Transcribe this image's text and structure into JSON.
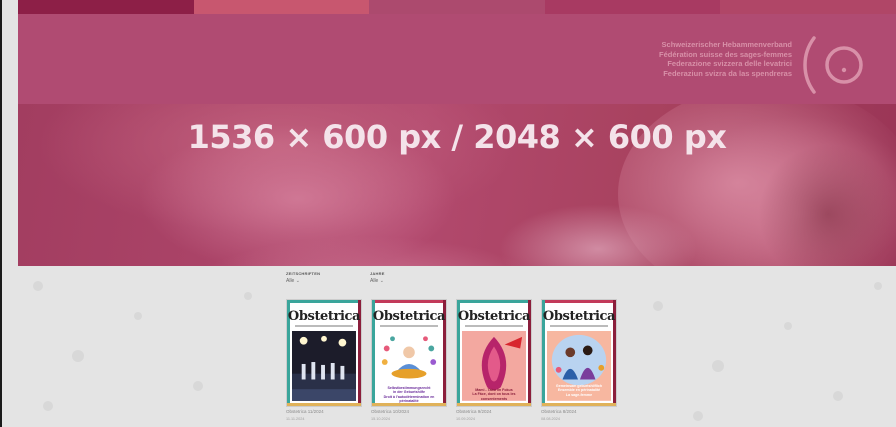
{
  "hero": {
    "title": "1536 × 600 px / 2048 × 600 px"
  },
  "header": {
    "org_names": [
      "Schweizerischer Hebammenverband",
      "Fédération suisse des sages-femmes",
      "Federazione svizzera delle levatrici",
      "Federaziun svizra da las spendreras"
    ],
    "logo_icon": "sshv-logo-icon"
  },
  "filters": [
    {
      "label": "ZEITSCHRIFTEN",
      "value": "Alle"
    },
    {
      "label": "JAHRE",
      "value": "Alle"
    }
  ],
  "covers": [
    {
      "brand": "Obstetrica",
      "accent_top": "#3aa59b",
      "accent_left": "#3aa59b",
      "accent_right": "#8b1f3c",
      "accent_bottom": "#e0b25a",
      "art": "concert-photo",
      "caption": "Obstetrica 11/2024",
      "date": "11.11.2024"
    },
    {
      "brand": "Obstetrica",
      "accent_top": "#c23a5a",
      "accent_left": "#3aa59b",
      "accent_right": "#8b1f3c",
      "accent_bottom": "#e0b25a",
      "art": "meditation-illustration",
      "cover_text": [
        "Selbstbestimmungsrecht",
        "in der Geburtshilfe",
        "Droit à l'autodétermination en périnatalité"
      ],
      "caption": "Obstetrica 10/2024",
      "date": "15.10.2024"
    },
    {
      "brand": "Obstetrica",
      "accent_top": "#3aa59b",
      "accent_left": "#3aa59b",
      "accent_right": "#8b1f3c",
      "accent_bottom": "#e0b25a",
      "art": "anatomy-illustration",
      "cover_text": [
        "Mami - Tabu im Fokus",
        "La Fâce, dont on tous les consentements"
      ],
      "caption": "Obstetrica 9/2024",
      "date": "10.09.2024"
    },
    {
      "brand": "Obstetrica",
      "accent_top": "#c23a5a",
      "accent_left": "#3aa59b",
      "accent_right": "#8b1f3c",
      "accent_bottom": "#e0b25a",
      "art": "women-illustration",
      "cover_text": [
        "Gemeinsam geburtshilflich",
        "Ensemble en périnatalité",
        "La sage-femme"
      ],
      "caption": "Obstetrica 8/2024",
      "date": "08.08.2024"
    }
  ],
  "colors": {
    "header_bg": "#b04b72",
    "hero_tint": "#a8425f",
    "page_bg": "#e4e4e4"
  }
}
